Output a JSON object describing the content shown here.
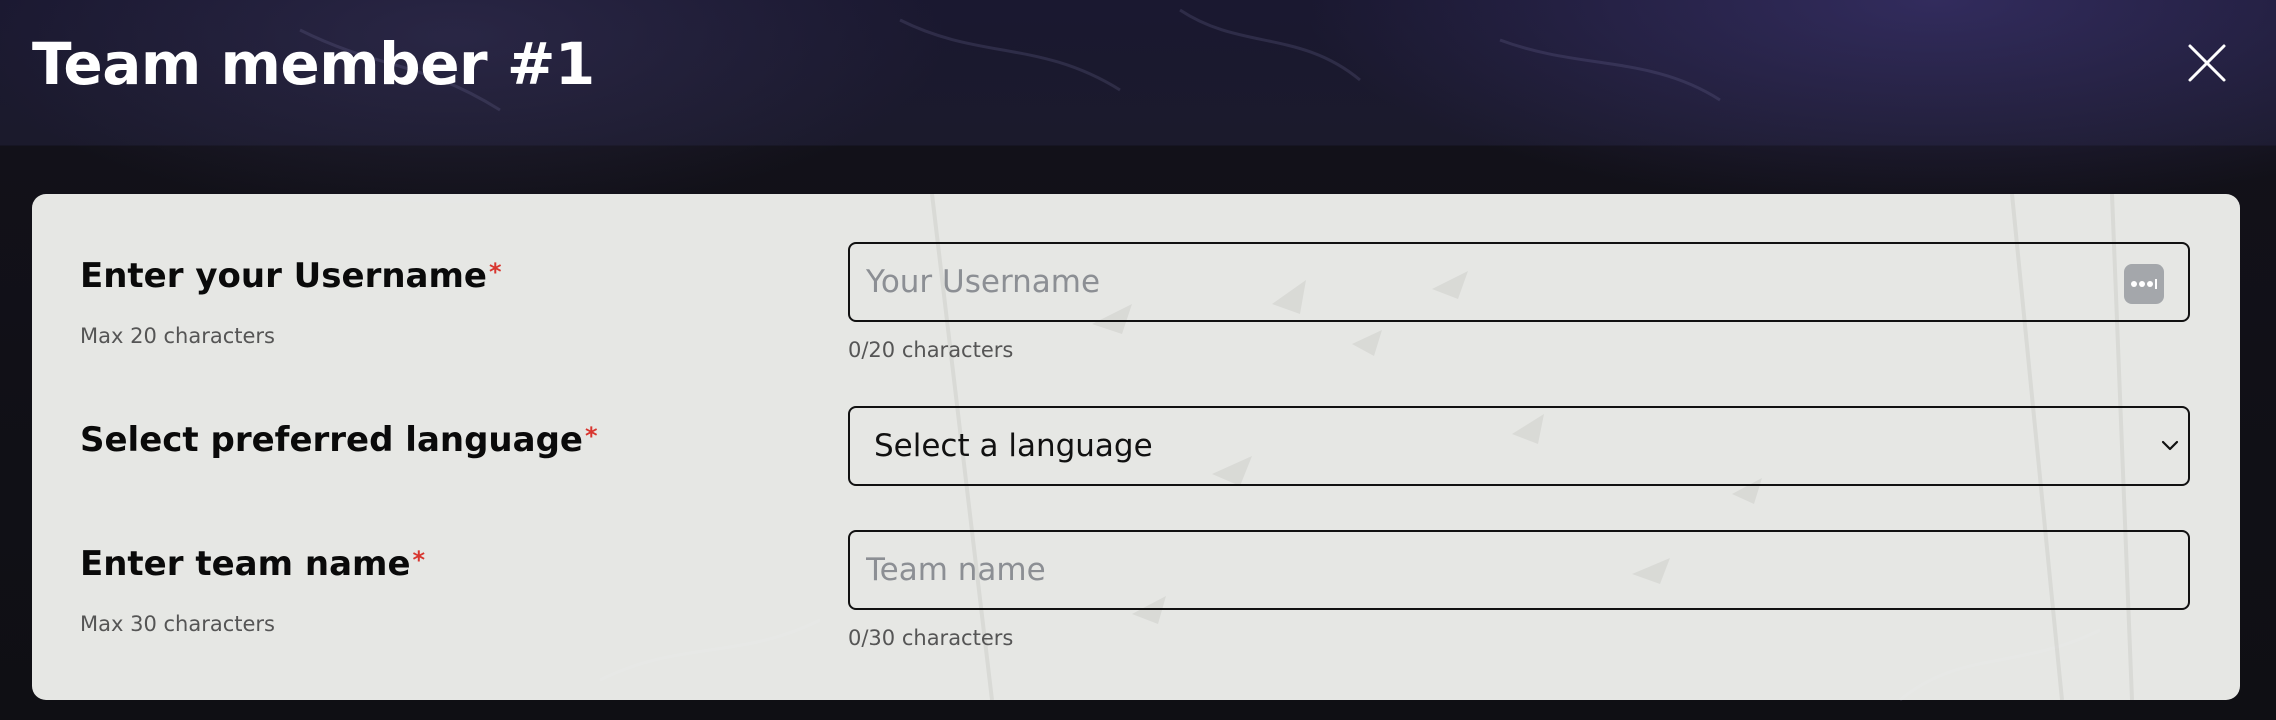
{
  "header": {
    "title": "Team member #1",
    "close_icon": "close-icon"
  },
  "form": {
    "username": {
      "label": "Enter your Username",
      "required_mark": "*",
      "hint": "Max 20 characters",
      "placeholder": "Your Username",
      "value": "",
      "counter": "0/20 characters",
      "trailing_icon": "password-manager-icon"
    },
    "language": {
      "label": "Select preferred language",
      "required_mark": "*",
      "selected": "Select a language",
      "icon": "chevron-down-icon"
    },
    "team_name": {
      "label": "Enter team name",
      "required_mark": "*",
      "hint": "Max 30 characters",
      "placeholder": "Team name",
      "value": "",
      "counter": "0/30 characters"
    }
  },
  "colors": {
    "required": "#d8362f",
    "header_text": "#ffffff",
    "card_background": "#f6f7f4",
    "border": "#111111"
  }
}
